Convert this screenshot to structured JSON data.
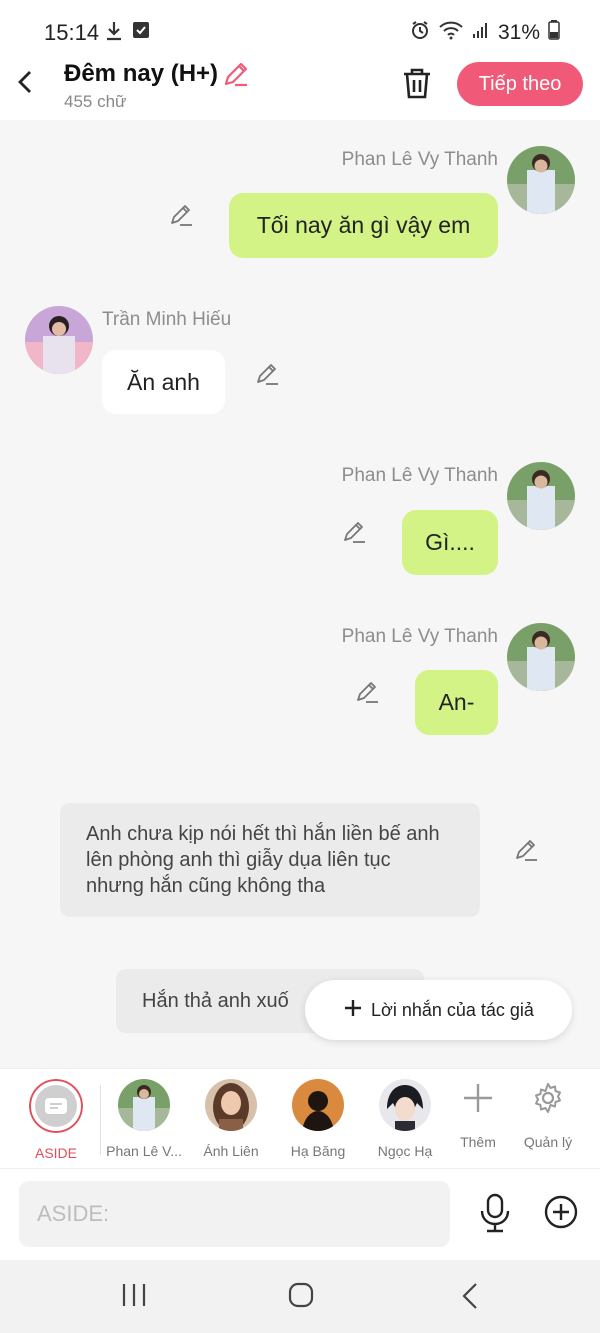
{
  "status_bar": {
    "time": "15:14",
    "battery": "31%"
  },
  "header": {
    "title": "Đêm nay (H+)",
    "word_count": "455 chữ",
    "next_label": "Tiếp theo"
  },
  "messages": [
    {
      "sender": "Phan Lê Vy Thanh",
      "text": "Tối nay ăn gì vậy em",
      "side": "right"
    },
    {
      "sender": "Trần Minh Hiếu",
      "text": "Ăn anh",
      "side": "left"
    },
    {
      "sender": "Phan Lê Vy Thanh",
      "text": "Gì....",
      "side": "right"
    },
    {
      "sender": "Phan Lê Vy Thanh",
      "text": "An-",
      "side": "right"
    }
  ],
  "narrations": [
    "Anh chưa kịp nói hết thì hắn liền bế anh lên phòng anh thì giẫy dụa liên tục nhưng hắn cũng không tha",
    "Hắn thả anh xuố"
  ],
  "author_note": {
    "label": "Lời nhắn của tác giả"
  },
  "characters": [
    {
      "label": "ASIDE"
    },
    {
      "label": "Phan Lê V..."
    },
    {
      "label": "Ánh Liên"
    },
    {
      "label": "Hạ Băng"
    },
    {
      "label": "Ngọc Hạ"
    },
    {
      "label": "Thêm"
    },
    {
      "label": "Quản lý"
    }
  ],
  "input": {
    "placeholder": "ASIDE:"
  },
  "colors": {
    "accent": "#f05a78",
    "bubble_green": "#d4f386",
    "aside_red": "#e0505a"
  }
}
